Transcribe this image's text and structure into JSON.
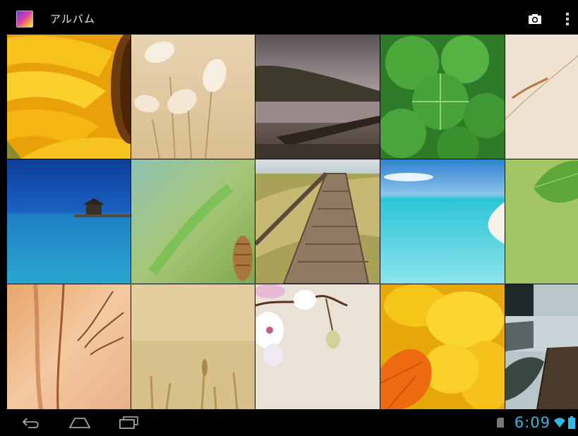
{
  "action_bar": {
    "title": "アルバム",
    "app_icon": "gallery-icon",
    "camera_icon": "camera-icon",
    "overflow_icon": "overflow-menu-icon"
  },
  "grid": {
    "photos": [
      {
        "subject": "sunflower"
      },
      {
        "subject": "bunny-tail-grass"
      },
      {
        "subject": "lake-pier-clouds"
      },
      {
        "subject": "clover-leaves"
      },
      {
        "subject": "dry-grass-beige"
      },
      {
        "subject": "ocean-pier-hut"
      },
      {
        "subject": "green-blur-pinecone"
      },
      {
        "subject": "boardwalk-dunes"
      },
      {
        "subject": "tropical-beach"
      },
      {
        "subject": "green-leaf"
      },
      {
        "subject": "golden-reeds"
      },
      {
        "subject": "wheat-field"
      },
      {
        "subject": "orchid-branch"
      },
      {
        "subject": "yellow-autumn-leaves"
      },
      {
        "subject": "lake-dock-boat"
      }
    ]
  },
  "nav_bar": {
    "back_icon": "back-icon",
    "home_icon": "home-icon",
    "recents_icon": "recent-apps-icon"
  },
  "status_bar": {
    "time": "6:09",
    "sd_icon": "sd-card-icon",
    "wifi_icon": "wifi-icon",
    "battery_icon": "battery-icon",
    "accent": "#33b5e5"
  }
}
